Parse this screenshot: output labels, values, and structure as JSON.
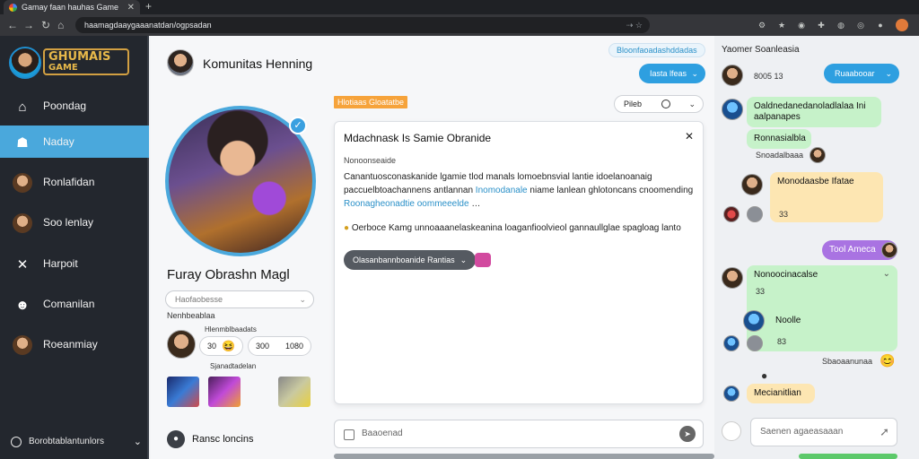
{
  "browser": {
    "tab_title": "Gamay faan hauhas Game",
    "url": "haamagdaaygaaanatdan/ogpsadan"
  },
  "sidebar": {
    "logo_top": "GHUMAIS",
    "logo_bottom": "GAME",
    "items": [
      {
        "label": "Poondag",
        "icon": "home-icon"
      },
      {
        "label": "Naday",
        "icon": "people-icon"
      },
      {
        "label": "Ronlafidan",
        "icon": "avatar-icon"
      },
      {
        "label": "Soo lenlay",
        "icon": "avatar-icon"
      },
      {
        "label": "Harpoit",
        "icon": "wrench-icon"
      },
      {
        "label": "Comanilan",
        "icon": "group-icon"
      },
      {
        "label": "Roeanmiay",
        "icon": "avatar-icon"
      }
    ],
    "bottom_label": "Borobtablantunlors"
  },
  "header": {
    "title": "Komunitas Henning"
  },
  "profile": {
    "name": "Furay Obrashn Magl",
    "select_placeholder": "Haofaobesse",
    "sub_label": "Nenhbeablaa",
    "stat_header": "Hlenmblbaadats",
    "stat_a": "30",
    "stat_b": "300",
    "stat_c": "1080",
    "tiles_label": "Sjanadtadelan"
  },
  "content": {
    "orange_badge": "Hlotiaas Gloatatbe",
    "filter_label": "Pileb",
    "card": {
      "title": "Mdachnask Is Samie Obranide",
      "subtitle": "Nonoonseaide",
      "paragraph_1": "Canantuosconaskanide lgamie tlod manals lomoebnsvial lantie idoelanoanaig paccuelbtoachannens antlannan",
      "highlight_1": "Inomodanale",
      "paragraph_1b": "niame lanlean ghlotoncans cnoomending",
      "highlight_2": "Roonagheonadtie oommeeelde",
      "paragraph_2": "Oerboce Kamg unnoaaanelaskeanina loaganfioolvieol gannaullglae spagloag lanto",
      "button_label": "Olasanbannboanide Rantias"
    },
    "footer_label": "Ransc loncins",
    "message_placeholder": "Baaoenad"
  },
  "chat": {
    "top_pill": "Bloonfaoadashddadas",
    "title": "Yaomer Soanleasia",
    "left_pill": "Iasta lfeas",
    "right_pill": "Ruaabooar",
    "m1_meta": "8005 13",
    "m2_text": "Oaldnedanedanoladlalaa Ini aalpanapes",
    "m2_sub": "Ronnasialbla",
    "m2_meta": "Snoadalbaaa",
    "m3_text": "Monodaasbe Ifatae",
    "m3_meta": "33",
    "m4_text": "Tool Ameca",
    "m5_text": "Nonoocinacalse",
    "m5_meta": "33",
    "m6_text": "Noolle",
    "m6_meta": "83",
    "m6_stamp": "Sbaoaanunaa",
    "m7_text": "Mecianitlian",
    "input_placeholder": "Saenen agaeasaaan"
  },
  "colors": {
    "sidebar_bg": "#23272e",
    "accent": "#4aa8dc",
    "orange": "#f6a33b",
    "chat_green": "#c6f2c9",
    "chat_yellow": "#fde6b2",
    "chat_purple": "#a973e2"
  }
}
